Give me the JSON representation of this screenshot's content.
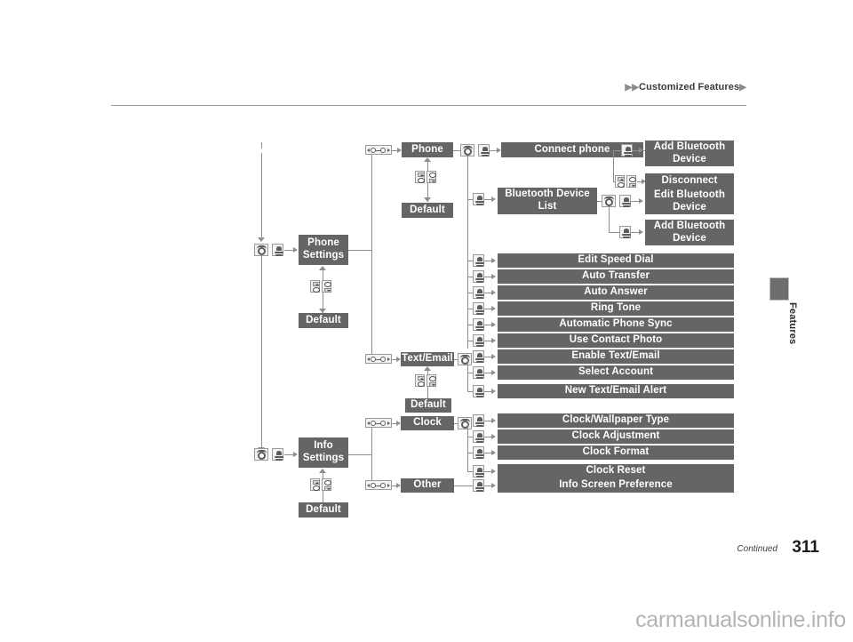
{
  "header": {
    "breadcrumb": "Customized Features",
    "tri_left": "▶▶",
    "tri_right": "▶"
  },
  "side_tab": {
    "label": "Features"
  },
  "footer": {
    "continued": "Continued",
    "page_number": "311",
    "watermark": "carmanualsonline.info"
  },
  "colors": {
    "node_fill": "#656565",
    "node_text": "#ffffff",
    "line": "#8e8e8e",
    "rule": "#9b9b9b"
  },
  "diagram": {
    "roots": [
      {
        "id": "phone-settings",
        "label": "Phone\nSettings"
      },
      {
        "id": "info-settings",
        "label": "Info\nSettings"
      }
    ],
    "defaults": [
      {
        "id": "default-phone-settings",
        "label": "Default"
      },
      {
        "id": "default-phone",
        "label": "Default"
      },
      {
        "id": "default-text-email",
        "label": "Default"
      },
      {
        "id": "default-info-settings",
        "label": "Default"
      }
    ],
    "categories": [
      {
        "id": "phone",
        "label": "Phone"
      },
      {
        "id": "text-email",
        "label": "Text/Email"
      },
      {
        "id": "clock",
        "label": "Clock"
      },
      {
        "id": "other",
        "label": "Other"
      }
    ],
    "phone_items": [
      {
        "id": "connect-phone",
        "label": "Connect phone"
      },
      {
        "id": "bluetooth-device-list",
        "label": "Bluetooth Device List"
      },
      {
        "id": "edit-speed-dial",
        "label": "Edit Speed Dial"
      },
      {
        "id": "auto-transfer",
        "label": "Auto Transfer"
      },
      {
        "id": "auto-answer",
        "label": "Auto Answer"
      },
      {
        "id": "ring-tone",
        "label": "Ring Tone"
      },
      {
        "id": "automatic-phone-sync",
        "label": "Automatic Phone Sync"
      },
      {
        "id": "use-contact-photo",
        "label": "Use Contact Photo"
      }
    ],
    "connect_phone_children": [
      {
        "id": "add-bluetooth-device-1",
        "label": "Add Bluetooth Device"
      },
      {
        "id": "disconnect",
        "label": "Disconnect"
      }
    ],
    "bt_list_children": [
      {
        "id": "edit-bluetooth-device",
        "label": "Edit Bluetooth Device"
      },
      {
        "id": "add-bluetooth-device-2",
        "label": "Add Bluetooth Device"
      }
    ],
    "text_email_items": [
      {
        "id": "enable-text-email",
        "label": "Enable Text/Email"
      },
      {
        "id": "select-account",
        "label": "Select Account"
      },
      {
        "id": "new-text-email-alert",
        "label": "New Text/Email Alert"
      }
    ],
    "clock_items": [
      {
        "id": "clock-wallpaper-type",
        "label": "Clock/Wallpaper Type"
      },
      {
        "id": "clock-adjustment",
        "label": "Clock Adjustment"
      },
      {
        "id": "clock-format",
        "label": "Clock Format"
      },
      {
        "id": "clock-reset",
        "label": "Clock Reset"
      }
    ],
    "other_items": [
      {
        "id": "info-screen-preference",
        "label": "Info Screen Preference"
      }
    ],
    "icons": {
      "knob": "rotary-knob-icon",
      "enter": "enter-button-icon",
      "select_up": "selector-up-icon",
      "select_down": "selector-down-icon",
      "menu_strip": "menu-strip-icon"
    }
  }
}
